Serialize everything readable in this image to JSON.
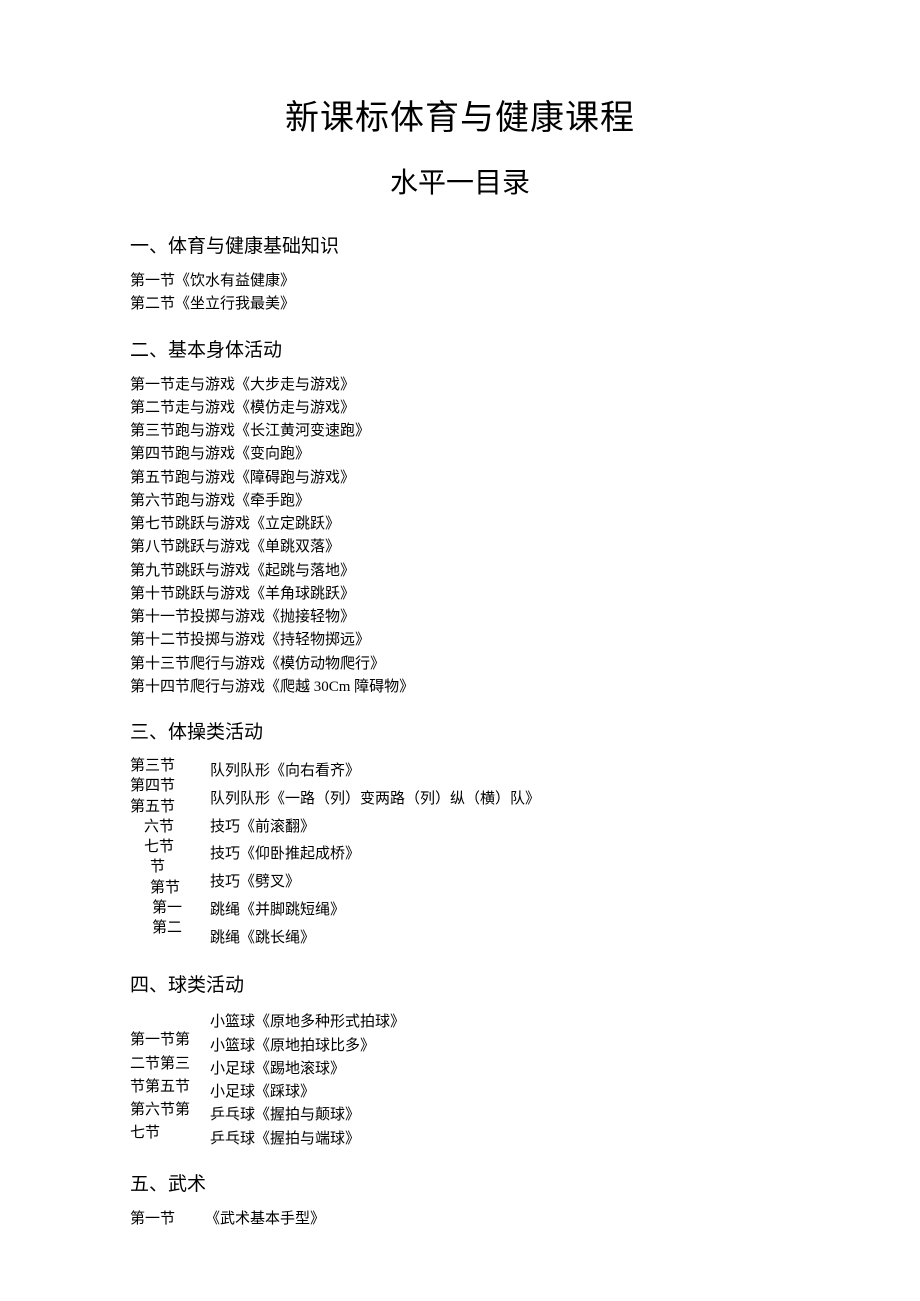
{
  "title": "新课标体育与健康课程",
  "subtitle": "水平一目录",
  "sections": [
    {
      "heading": "一、体育与健康基础知识",
      "layout": "plain",
      "items": [
        "第一节《饮水有益健康》",
        "第二节《坐立行我最美》"
      ]
    },
    {
      "heading": "二、基本身体活动",
      "layout": "plain",
      "items": [
        "第一节走与游戏《大步走与游戏》",
        "第二节走与游戏《模仿走与游戏》",
        "第三节跑与游戏《长江黄河变速跑》",
        "第四节跑与游戏《变向跑》",
        "第五节跑与游戏《障碍跑与游戏》",
        "第六节跑与游戏《牵手跑》",
        "第七节跳跃与游戏《立定跳跃》",
        "第八节跳跃与游戏《单跳双落》",
        "第九节跳跃与游戏《起跳与落地》",
        "第十节跳跃与游戏《羊角球跳跃》",
        "第十一节投掷与游戏《抛接轻物》",
        "第十二节投掷与游戏《持轻物掷远》",
        "第十三节爬行与游戏《模仿动物爬行》",
        "第十四节爬行与游戏《爬越 30Cm 障碍物》"
      ]
    },
    {
      "heading": "三、体操类活动",
      "layout": "two-col",
      "left": [
        "第三节",
        "第四节",
        "第五节",
        "六节",
        "七节",
        "节",
        "第节",
        "第一",
        "第二"
      ],
      "right": [
        "队列队形《向右看齐》",
        "队列队形《一路（列）变两路（列）纵（横）队》",
        "技巧《前滚翻》",
        "技巧《仰卧推起成桥》",
        "技巧《劈叉》",
        "跳绳《并脚跳短绳》",
        "跳绳《跳长绳》"
      ]
    },
    {
      "heading": "四、球类活动",
      "layout": "two-col",
      "left": [
        "",
        "第一节第",
        "二节第三",
        "节第五节",
        "第六节第",
        "七节"
      ],
      "right": [
        "小篮球《原地多种形式拍球》",
        "小篮球《原地拍球比多》",
        "小足球《踢地滚球》",
        "小足球《踩球》",
        "乒乓球《握拍与颠球》",
        "乒乓球《握拍与端球》"
      ]
    },
    {
      "heading": "五、武术",
      "layout": "plain-indent",
      "items": [
        "第一节        《武术基本手型》"
      ]
    }
  ]
}
